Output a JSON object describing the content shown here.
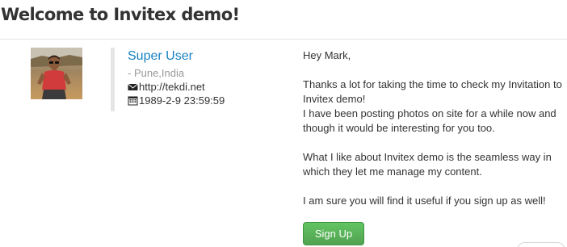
{
  "header": {
    "title": "Welcome to Invitex demo!"
  },
  "profile": {
    "name": "Super User",
    "location": "- Pune,India",
    "website": "http://tekdi.net",
    "datetime": "1989-2-9 23:59:59",
    "website_icon": "envelope-icon",
    "datetime_icon": "calendar-icon"
  },
  "message": {
    "greeting": "Hey Mark,",
    "paragraph1_line1": "Thanks a lot for taking the time to check my Invitation to",
    "paragraph1_line2": "Invitex demo!",
    "paragraph1_line3": "I have been posting photos on site for a while now and",
    "paragraph1_line4": "though it would be interesting for you too.",
    "paragraph2_line1": "What I like about Invitex demo is the seamless way in",
    "paragraph2_line2": "which they let me manage my content.",
    "paragraph3": "I am sure you will find it useful if you sign up as well!"
  },
  "actions": {
    "signup_label": "Sign Up"
  },
  "colors": {
    "link": "#1a82c1",
    "button": "#5bb75b",
    "muted": "#999999"
  }
}
